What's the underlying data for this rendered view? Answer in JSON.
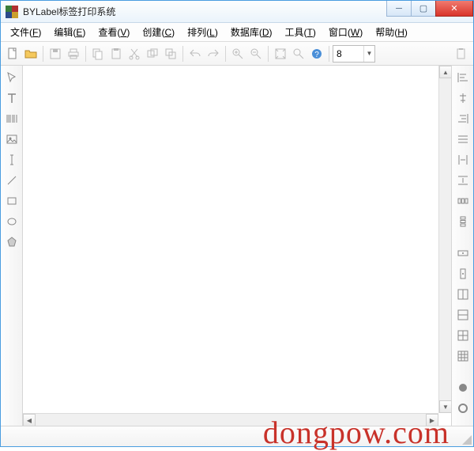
{
  "window": {
    "title": "BYLabel标签打印系统"
  },
  "menu": {
    "file": {
      "label": "文件",
      "accel": "F"
    },
    "edit": {
      "label": "编辑",
      "accel": "E"
    },
    "view": {
      "label": "查看",
      "accel": "V"
    },
    "create": {
      "label": "创建",
      "accel": "C"
    },
    "arrange": {
      "label": "排列",
      "accel": "L"
    },
    "database": {
      "label": "数据库",
      "accel": "D"
    },
    "tools": {
      "label": "工具",
      "accel": "T"
    },
    "windowm": {
      "label": "窗口",
      "accel": "W"
    },
    "help": {
      "label": "帮助",
      "accel": "H"
    }
  },
  "toolbar": {
    "new": "new",
    "open": "open",
    "save": "save",
    "print": "print",
    "copy": "copy",
    "paste": "paste",
    "cut": "cut",
    "dup1": "dup1",
    "dup2": "dup2",
    "undo": "undo",
    "redo": "redo",
    "zoomin": "zoomin",
    "zoomout": "zoomout",
    "fit": "fit",
    "zoom100": "zoom100",
    "help": "help",
    "spin_value": "8",
    "last": "paste-ext"
  },
  "left_tools": [
    "pointer",
    "text",
    "barcode",
    "image",
    "hline",
    "line",
    "rect",
    "circle",
    "shape"
  ],
  "right_tools": [
    "align-left",
    "align-center",
    "align-right",
    "align-just",
    "dist-h",
    "dist-v",
    "spread-h",
    "spread-v",
    "sep",
    "center-h",
    "center-v",
    "sep",
    "grid1",
    "grid2",
    "grid3",
    "grid4",
    "sep",
    "fill",
    "stroke"
  ],
  "watermark": "dongpow.com"
}
